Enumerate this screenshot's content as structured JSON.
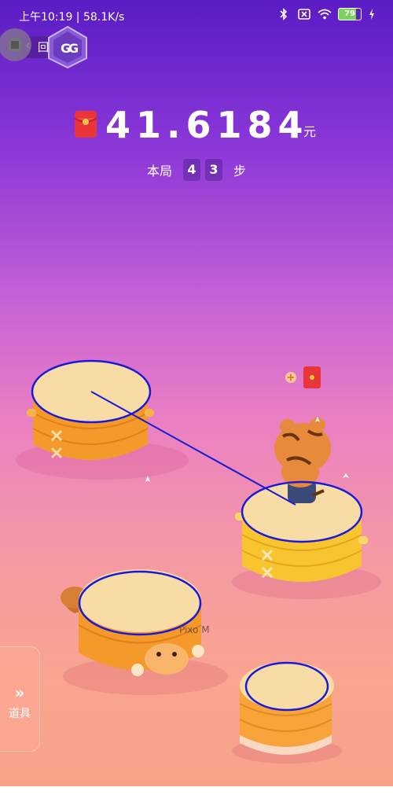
{
  "status_bar": {
    "time_speed": "上午10:19 | 58.1K/s",
    "battery_level": "79"
  },
  "top_bar": {
    "back_label": "回",
    "overlay_logo_letters": "GG"
  },
  "game": {
    "money_value": "41.6184",
    "money_unit": "元",
    "steps_prefix": "本局",
    "step_digits": [
      "4",
      "3"
    ],
    "steps_suffix": "步",
    "watermark": "Pixo M"
  },
  "side_panel": {
    "chevron": "»",
    "label": "道具"
  },
  "colors": {
    "bg_top": "#5a1cc4",
    "bg_bottom": "#f7a288",
    "drum_orange": "#f59a2a",
    "drum_yellow": "#f8c531",
    "drum_top": "#f7dca6",
    "outline_blue": "#1a1ad6",
    "red_packet": "#e8353a"
  },
  "icons": [
    "bluetooth-icon",
    "sim-icon",
    "wifi-icon",
    "battery-icon",
    "charging-icon",
    "red-packet-icon",
    "plus-icon",
    "tiger-character-icon",
    "cat-drum-icon"
  ]
}
